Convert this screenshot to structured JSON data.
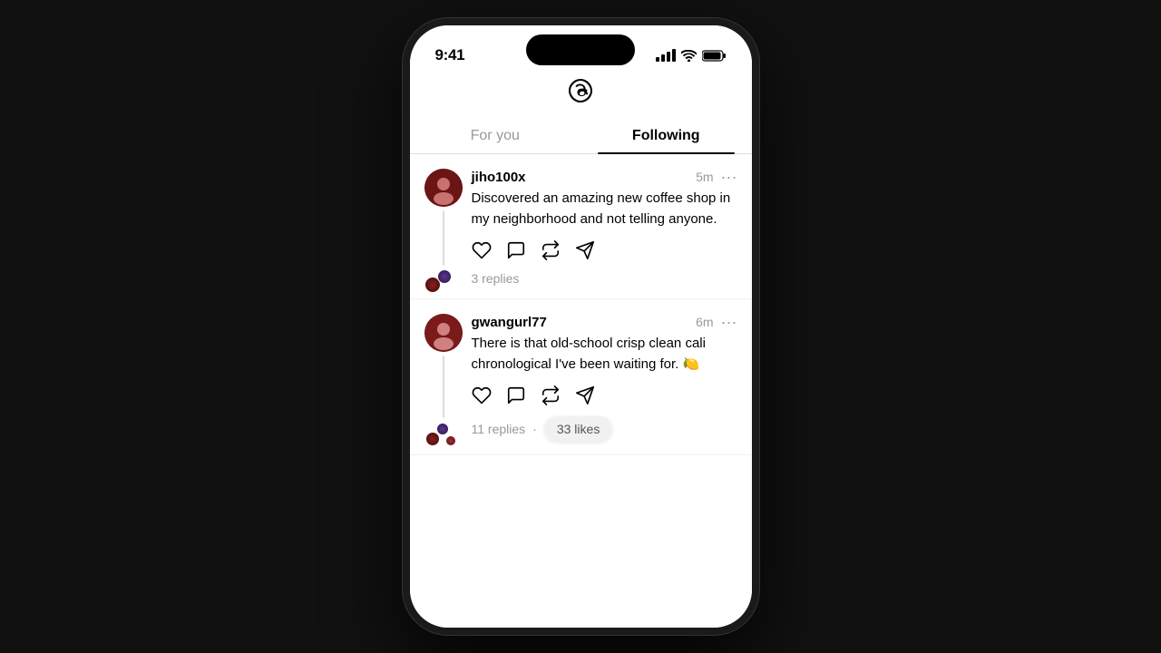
{
  "statusBar": {
    "time": "9:41",
    "signalLabel": "signal",
    "wifiLabel": "wifi",
    "batteryLabel": "battery"
  },
  "header": {
    "logoAlt": "Threads",
    "tabs": [
      {
        "id": "for-you",
        "label": "For you",
        "active": false
      },
      {
        "id": "following",
        "label": "Following",
        "active": true
      }
    ]
  },
  "feed": {
    "posts": [
      {
        "id": "post-1",
        "username": "jiho100x",
        "time": "5m",
        "content": "Discovered an amazing new coffee shop in my neighborhood and not telling anyone.",
        "repliesCount": "3 replies",
        "likesCount": "",
        "actions": [
          "like",
          "comment",
          "repost",
          "share"
        ]
      },
      {
        "id": "post-2",
        "username": "gwangurl77",
        "time": "6m",
        "content": "There is that old-school crisp clean cali chronological I've been waiting for. 🍋",
        "repliesCount": "11 replies",
        "likesCount": "33 likes",
        "actions": [
          "like",
          "comment",
          "repost",
          "share"
        ]
      }
    ]
  }
}
